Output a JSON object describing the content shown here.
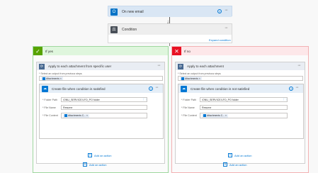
{
  "trigger": {
    "title": "On new email",
    "icon": "outlook-icon"
  },
  "condition": {
    "title": "Condition",
    "expand_link": "Expand condition"
  },
  "branch_yes": {
    "label": "If yes",
    "color": "#57a300",
    "loop_title": "Apply to each attachment from specific user",
    "select_label": "* Select an output from previous steps",
    "attachments_token": "Attachments",
    "create_title": "Create file when condition is satisfied",
    "folder_label": "* Folder Path",
    "folder_value": "/ONU_SERVICE/LFO_PO folder",
    "name_label": "* File Name",
    "name_value": "Resume",
    "content_label": "* File Content",
    "content_token": "Attachments C...",
    "inner_add": "Add an action",
    "outer_add": "Add an action"
  },
  "branch_no": {
    "label": "If no",
    "color": "#e81123",
    "loop_title": "Apply to each attachment",
    "select_label": "* Select an output from previous steps",
    "attachments_token": "Attachments",
    "create_title": "Create file when condition is not satisfied",
    "folder_label": "* Folder Path",
    "folder_value": "/ONU_SERVICE/LFO_PO folder",
    "name_label": "* File Name",
    "name_value": "Resume",
    "content_label": "* File Content",
    "content_token": "Attachments C...",
    "inner_add": "Add an action",
    "outer_add": "Add an action"
  },
  "more_glyph": "···",
  "info_glyph": "?",
  "close_glyph": "×",
  "plus_glyph": "+",
  "arrow_glyph": "↓",
  "check_glyph": "✓",
  "cross_glyph": "✕"
}
